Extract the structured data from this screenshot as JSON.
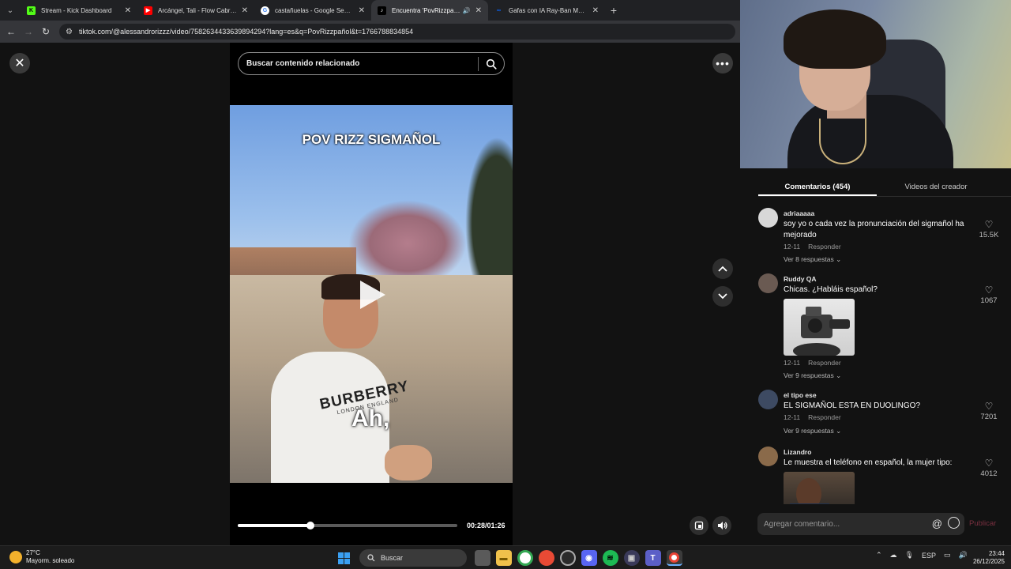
{
  "browser": {
    "tabs": [
      {
        "title": "Stream - Kick Dashboard",
        "icon": "kick-icon",
        "color": "#53fc18",
        "active": false
      },
      {
        "title": "Arcángel, Tali - Flow Cabrón (V",
        "icon": "youtube-icon",
        "color": "#ff0000",
        "active": false
      },
      {
        "title": "castañuelas - Google Search",
        "icon": "google-icon",
        "color": "#4285f4",
        "active": false
      },
      {
        "title": "Encuentra 'PovRizzpañol' e",
        "icon": "tiktok-icon",
        "color": "#000000",
        "active": true,
        "audio": true
      },
      {
        "title": "Gafas con IA Ray-Ban Meta Sky",
        "icon": "meta-icon",
        "color": "#0866ff",
        "active": false
      }
    ],
    "url": "tiktok.com/@alessandrorizzz/video/7582634433639894294?lang=es&q=PovRizzpañol&t=1766788834854"
  },
  "viewer": {
    "search_placeholder": "Buscar contenido relacionado",
    "caption_top": "POV RIZZ SIGMAÑOL",
    "caption_sub": "Ah,",
    "shirt_brand": "BURBERRY",
    "shirt_sub": "LONDON ENGLAND",
    "progress": 0.33,
    "time": "00:28/01:26"
  },
  "panel": {
    "tabs": [
      "Comentarios (454)",
      "Videos del creador"
    ],
    "comments": [
      {
        "user": "adriaaaaa",
        "text": "soy yo o cada vez la pronunciación del sigmañol ha mejorado",
        "date": "12-11",
        "reply": "Responder",
        "more": "Ver 8 respuestas",
        "likes": "15.5K"
      },
      {
        "user": "Ruddy QA",
        "text": "Chicas. ¿Habláis español?",
        "date": "12-11",
        "reply": "Responder",
        "more": "Ver 9 respuestas",
        "likes": "1067"
      },
      {
        "user": "el tipo ese",
        "text": "EL SIGMAÑOL ESTA EN DUOLINGO?",
        "date": "12-11",
        "reply": "Responder",
        "more": "Ver 9 respuestas",
        "likes": "7201"
      },
      {
        "user": "Lizandro",
        "text": "Le muestra el teléfono en español, la mujer tipo:",
        "likes": "4012"
      }
    ],
    "compose_placeholder": "Agregar comentario...",
    "publish": "Publicar"
  },
  "taskbar": {
    "temp": "27°C",
    "weather": "Mayorm. soleado",
    "search": "Buscar",
    "lang": "ESP",
    "time": "23:44",
    "date": "26/12/2025"
  }
}
